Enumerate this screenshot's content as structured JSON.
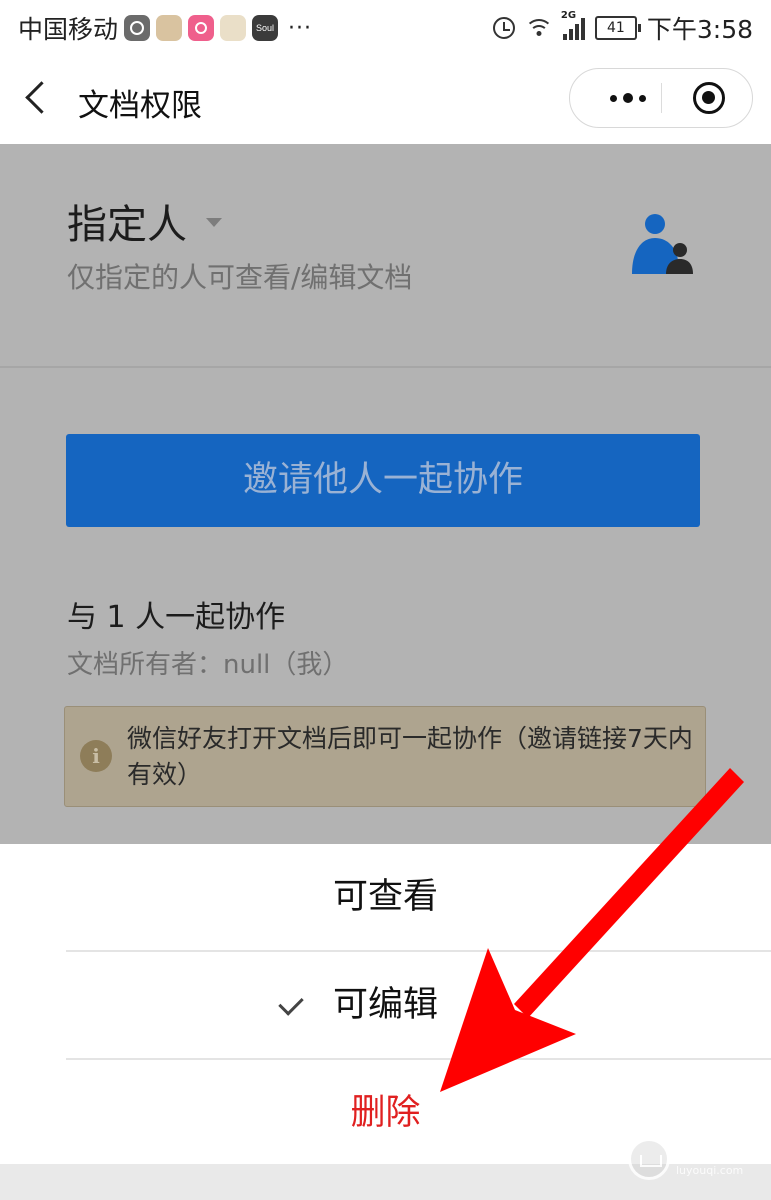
{
  "status_bar": {
    "carrier": "中国移动",
    "more": "···",
    "network": "2G",
    "battery": "41",
    "time": "下午3:58"
  },
  "nav": {
    "title": "文档权限"
  },
  "permission": {
    "mode": "指定人",
    "description": "仅指定的人可查看/编辑文档"
  },
  "invite_button": "邀请他人一起协作",
  "collaborators": {
    "count_text": "与 1 人一起协作",
    "owner_text": "文档所有者：null（我）"
  },
  "notice": {
    "text": "微信好友打开文档后即可一起协作（邀请链接7天内有效）"
  },
  "action_sheet": {
    "items": [
      {
        "label": "可查看",
        "selected": false
      },
      {
        "label": "可编辑",
        "selected": true
      },
      {
        "label": "删除",
        "destructive": true
      }
    ]
  },
  "watermark": {
    "name": "路由器",
    "domain": "luyouqi.com"
  },
  "colors": {
    "primary": "#1565c0",
    "danger": "#e02020",
    "annotation_arrow": "#ff0000"
  }
}
